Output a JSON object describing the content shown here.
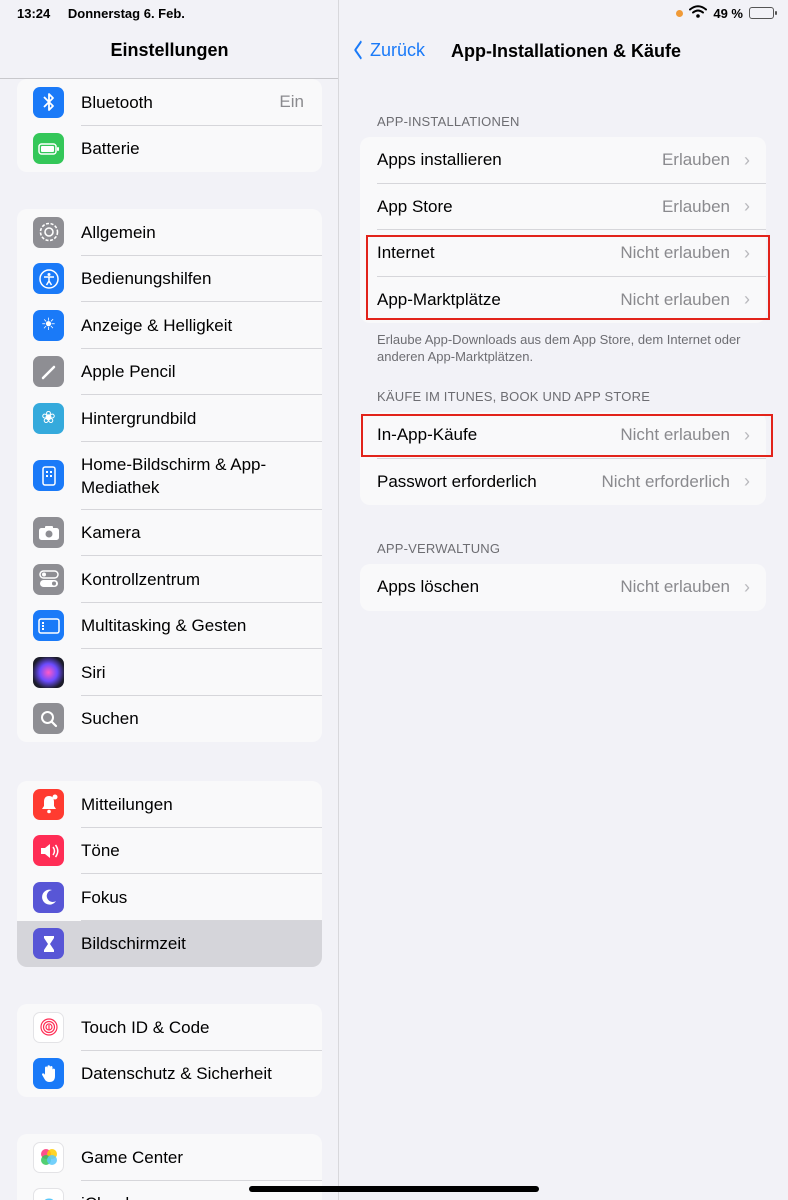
{
  "status": {
    "time": "13:24",
    "date": "Donnerstag 6. Feb.",
    "battery": "49 %",
    "battery_level": 0.49
  },
  "sidebar": {
    "title": "Einstellungen",
    "groups": [
      [
        {
          "label": "Bluetooth",
          "value": "Ein",
          "icon": "bluetooth-icon",
          "color": "#1a7af8"
        },
        {
          "label": "Batterie",
          "icon": "battery-icon",
          "color": "#34c759"
        }
      ],
      [
        {
          "label": "Allgemein",
          "icon": "gear-icon",
          "color": "#8e8e93"
        },
        {
          "label": "Bedienungshilfen",
          "icon": "accessibility-icon",
          "color": "#1a7af8"
        },
        {
          "label": "Anzeige & Helligkeit",
          "icon": "sun-icon",
          "color": "#1a7af8"
        },
        {
          "label": "Apple Pencil",
          "icon": "pencil-icon",
          "color": "#8e8e93"
        },
        {
          "label": "Hintergrundbild",
          "icon": "flower-icon",
          "color": "#35aadc"
        },
        {
          "label": "Home-Bildschirm & App-Mediathek",
          "icon": "home-screen-icon",
          "color": "#1a7af8"
        },
        {
          "label": "Kamera",
          "icon": "camera-icon",
          "color": "#8e8e93"
        },
        {
          "label": "Kontrollzentrum",
          "icon": "toggles-icon",
          "color": "#8e8e93"
        },
        {
          "label": "Multitasking & Gesten",
          "icon": "multitasking-icon",
          "color": "#1a7af8"
        },
        {
          "label": "Siri",
          "icon": "siri-icon",
          "color": "#222222"
        },
        {
          "label": "Suchen",
          "icon": "search-icon",
          "color": "#8e8e93"
        }
      ],
      [
        {
          "label": "Mitteilungen",
          "icon": "bell-icon",
          "color": "#ff3b30"
        },
        {
          "label": "Töne",
          "icon": "speaker-icon",
          "color": "#ff2d55"
        },
        {
          "label": "Fokus",
          "icon": "moon-icon",
          "color": "#5856d6"
        },
        {
          "label": "Bildschirmzeit",
          "icon": "hourglass-icon",
          "color": "#5856d6"
        }
      ],
      [
        {
          "label": "Touch ID & Code",
          "icon": "fingerprint-icon",
          "color": "#ffffff"
        },
        {
          "label": "Datenschutz & Sicherheit",
          "icon": "hand-icon",
          "color": "#1a7af8"
        }
      ],
      [
        {
          "label": "Game Center",
          "icon": "game-center-icon",
          "color": "#ffffff"
        },
        {
          "label": "iCloud",
          "icon": "cloud-icon",
          "color": "#ffffff"
        }
      ]
    ]
  },
  "detail": {
    "back_label": "Zurück",
    "title": "App-Installationen & Käufe",
    "sections": [
      {
        "header": "APP-INSTALLATIONEN",
        "rows": [
          {
            "label": "Apps installieren",
            "value": "Erlauben"
          },
          {
            "label": "App Store",
            "value": "Erlauben"
          },
          {
            "label": "Internet",
            "value": "Nicht erlauben"
          },
          {
            "label": "App-Marktplätze",
            "value": "Nicht erlauben"
          }
        ],
        "footer": "Erlaube App-Downloads aus dem App Store, dem Internet oder anderen App-Marktplätzen."
      },
      {
        "header": "KÄUFE IM ITUNES, BOOK UND APP STORE",
        "rows": [
          {
            "label": "In-App-Käufe",
            "value": "Nicht erlauben"
          },
          {
            "label": "Passwort erforderlich",
            "value": "Nicht erforderlich"
          }
        ]
      },
      {
        "header": "APP-VERWALTUNG",
        "rows": [
          {
            "label": "Apps löschen",
            "value": "Nicht erlauben"
          }
        ]
      }
    ]
  },
  "accent_color": "#1a7af8",
  "highlight_color": "#e2231a"
}
